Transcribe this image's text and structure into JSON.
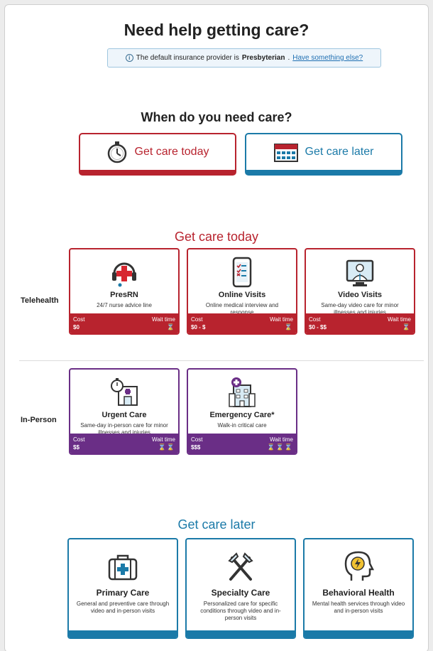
{
  "page": {
    "title": "Need help getting care?",
    "info_prefix": "The default insurance provider is",
    "info_provider": "Presbyterian",
    "info_period": ".",
    "info_link": "Have something else?",
    "when_title": "When do you need care?",
    "btn_today": "Get care today",
    "btn_later": "Get care later",
    "section_today": "Get care today",
    "section_later": "Get care later",
    "row_telehealth": "Telehealth",
    "row_inperson": "In-Person"
  },
  "telehealth": [
    {
      "name": "PresRN",
      "desc": "24/7 nurse advice line",
      "cost_label": "Cost",
      "cost": "$0",
      "wait_label": "Wait time",
      "wait": "⌛",
      "icon": "headset-medical-icon"
    },
    {
      "name": "Online Visits",
      "desc": "Online medical interview and response",
      "cost_label": "Cost",
      "cost": "$0 - $",
      "wait_label": "Wait time",
      "wait": "⌛",
      "icon": "phone-checklist-icon"
    },
    {
      "name": "Video Visits",
      "desc": "Same-day video care for minor illnesses and injuries",
      "cost_label": "Cost",
      "cost": "$0 - $$",
      "wait_label": "Wait time",
      "wait": "⌛",
      "icon": "video-doctor-icon"
    }
  ],
  "inperson": [
    {
      "name": "Urgent Care",
      "desc": "Same-day in-person care for minor illnesses and injuries",
      "cost_label": "Cost",
      "cost": "$$",
      "wait_label": "Wait time",
      "wait": "⌛⌛",
      "icon": "clinic-stopwatch-icon"
    },
    {
      "name": "Emergency Care*",
      "desc": "Walk-in critical care",
      "cost_label": "Cost",
      "cost": "$$$",
      "wait_label": "Wait time",
      "wait": "⌛⌛⌛",
      "icon": "hospital-icon"
    }
  ],
  "later": [
    {
      "name": "Primary Care",
      "desc": "General and preventive care through video and in-person visits",
      "icon": "medical-bag-icon"
    },
    {
      "name": "Specialty Care",
      "desc": "Personalized care for specific conditions through video and in-person visits",
      "icon": "crossed-tools-icon"
    },
    {
      "name": "Behavioral Health",
      "desc": "Mental health services through video and in-person visits",
      "icon": "head-lightning-icon"
    }
  ],
  "colors": {
    "red": "#b8232e",
    "purple": "#6a2e86",
    "blue": "#1b7aa8"
  }
}
